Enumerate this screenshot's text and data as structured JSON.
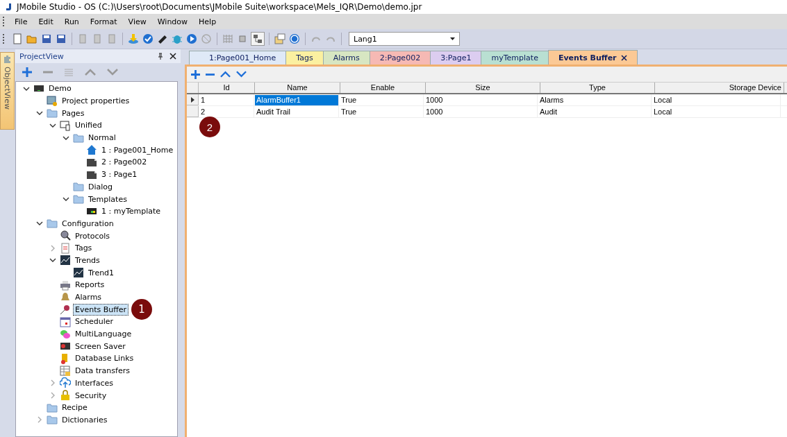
{
  "window": {
    "title": "JMobile Studio - OS (C:)\\Users\\root\\Documents\\JMobile Suite\\workspace\\Mels_IQR\\Demo\\demo.jpr"
  },
  "menu": [
    "File",
    "Edit",
    "Run",
    "Format",
    "View",
    "Window",
    "Help"
  ],
  "language_select": {
    "value": "Lang1"
  },
  "side_tab": {
    "label": "ObjectView"
  },
  "project_view": {
    "title": "ProjectView",
    "tree": [
      {
        "label": "Demo",
        "kind": "device",
        "expanded": true,
        "selected": false,
        "children": [
          {
            "label": "Project properties",
            "kind": "properties",
            "selected": false
          },
          {
            "label": "Pages",
            "kind": "folder",
            "expanded": true,
            "selected": false,
            "children": [
              {
                "label": "Unified",
                "kind": "unified",
                "expanded": true,
                "selected": false,
                "children": [
                  {
                    "label": "Normal",
                    "kind": "folder",
                    "expanded": true,
                    "selected": false,
                    "children": [
                      {
                        "label": "1 : Page001_Home",
                        "kind": "home",
                        "selected": false
                      },
                      {
                        "label": "2 : Page002",
                        "kind": "page",
                        "selected": false
                      },
                      {
                        "label": "3 : Page1",
                        "kind": "page",
                        "selected": false
                      }
                    ]
                  },
                  {
                    "label": "Dialog",
                    "kind": "folder",
                    "selected": false
                  },
                  {
                    "label": "Templates",
                    "kind": "folder",
                    "expanded": true,
                    "selected": false,
                    "children": [
                      {
                        "label": "1 : myTemplate",
                        "kind": "template",
                        "selected": false
                      }
                    ]
                  }
                ]
              }
            ]
          },
          {
            "label": "Configuration",
            "kind": "folder",
            "expanded": true,
            "selected": false,
            "children": [
              {
                "label": "Protocols",
                "kind": "protocol",
                "selected": false
              },
              {
                "label": "Tags",
                "kind": "tags",
                "expanded": false,
                "selected": false
              },
              {
                "label": "Trends",
                "kind": "trend",
                "expanded": true,
                "selected": false,
                "children": [
                  {
                    "label": "Trend1",
                    "kind": "trend",
                    "selected": false
                  }
                ]
              },
              {
                "label": "Reports",
                "kind": "printer",
                "selected": false
              },
              {
                "label": "Alarms",
                "kind": "bell",
                "selected": false
              },
              {
                "label": "Events Buffer",
                "kind": "pin",
                "selected": true
              },
              {
                "label": "Scheduler",
                "kind": "calendar",
                "selected": false
              },
              {
                "label": "MultiLanguage",
                "kind": "chat",
                "selected": false
              },
              {
                "label": "Screen Saver",
                "kind": "screensaver",
                "selected": false
              },
              {
                "label": "Database Links",
                "kind": "database",
                "selected": false
              },
              {
                "label": "Data transfers",
                "kind": "table",
                "selected": false
              },
              {
                "label": "Interfaces",
                "kind": "cloud",
                "expanded": false,
                "selected": false
              },
              {
                "label": "Security",
                "kind": "lock",
                "expanded": false,
                "selected": false
              }
            ]
          },
          {
            "label": "Recipe",
            "kind": "folder",
            "selected": false
          },
          {
            "label": "Dictionaries",
            "kind": "folder",
            "expanded": false,
            "selected": false
          }
        ]
      }
    ]
  },
  "tabs": [
    {
      "label": "1:Page001_Home",
      "color": "#dfe9f7",
      "selected": false
    },
    {
      "label": "Tags",
      "color": "#fbf0a0",
      "selected": false
    },
    {
      "label": "Alarms",
      "color": "#d7e6c2",
      "selected": false
    },
    {
      "label": "2:Page002",
      "color": "#f6b9b4",
      "selected": false
    },
    {
      "label": "3:Page1",
      "color": "#dccdf0",
      "selected": false
    },
    {
      "label": "myTemplate",
      "color": "#b9e0d2",
      "selected": false
    },
    {
      "label": "Events Buffer",
      "color": "#fbc995",
      "selected": true
    }
  ],
  "grid": {
    "columns": [
      "Id",
      "Name",
      "Enable",
      "Size",
      "Type",
      "Storage Device"
    ],
    "rows": [
      {
        "current": true,
        "cells": [
          {
            "text": "1",
            "selected": false
          },
          {
            "text": "AlarmBuffer1",
            "selected": true
          },
          {
            "text": "True",
            "selected": false
          },
          {
            "text": "1000",
            "selected": false
          },
          {
            "text": "Alarms",
            "selected": false
          },
          {
            "text": "Local",
            "selected": false
          }
        ]
      },
      {
        "current": false,
        "cells": [
          {
            "text": "2",
            "selected": false
          },
          {
            "text": "Audit Trail",
            "selected": false
          },
          {
            "text": "True",
            "selected": false
          },
          {
            "text": "1000",
            "selected": false
          },
          {
            "text": "Audit",
            "selected": false
          },
          {
            "text": "Local",
            "selected": false
          }
        ]
      }
    ]
  },
  "callouts": [
    {
      "label": "1"
    },
    {
      "label": "2"
    }
  ]
}
